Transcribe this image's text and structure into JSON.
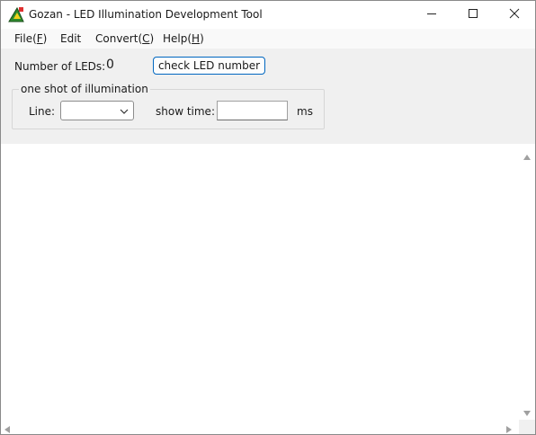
{
  "window": {
    "title": "Gozan - LED Illumination Development Tool",
    "icon": "led-app-icon"
  },
  "menu": {
    "file": {
      "pre": "File(",
      "key": "F",
      "post": ")"
    },
    "edit": {
      "label": "Edit"
    },
    "convert": {
      "pre": "Convert(",
      "key": "C",
      "post": ")"
    },
    "help": {
      "pre": "Help(",
      "key": "H",
      "post": ")"
    }
  },
  "controls": {
    "led_label": "Number of LEDs:",
    "led_count": "0",
    "check_button": "check LED number",
    "group_title": "one shot of illumination",
    "line_label": "Line:",
    "line_value": "",
    "show_time_label": "show time:",
    "show_time_value": "",
    "ms_label": "ms"
  },
  "colors": {
    "accent": "#0067c0",
    "window_bg": "#f0f0f0"
  }
}
